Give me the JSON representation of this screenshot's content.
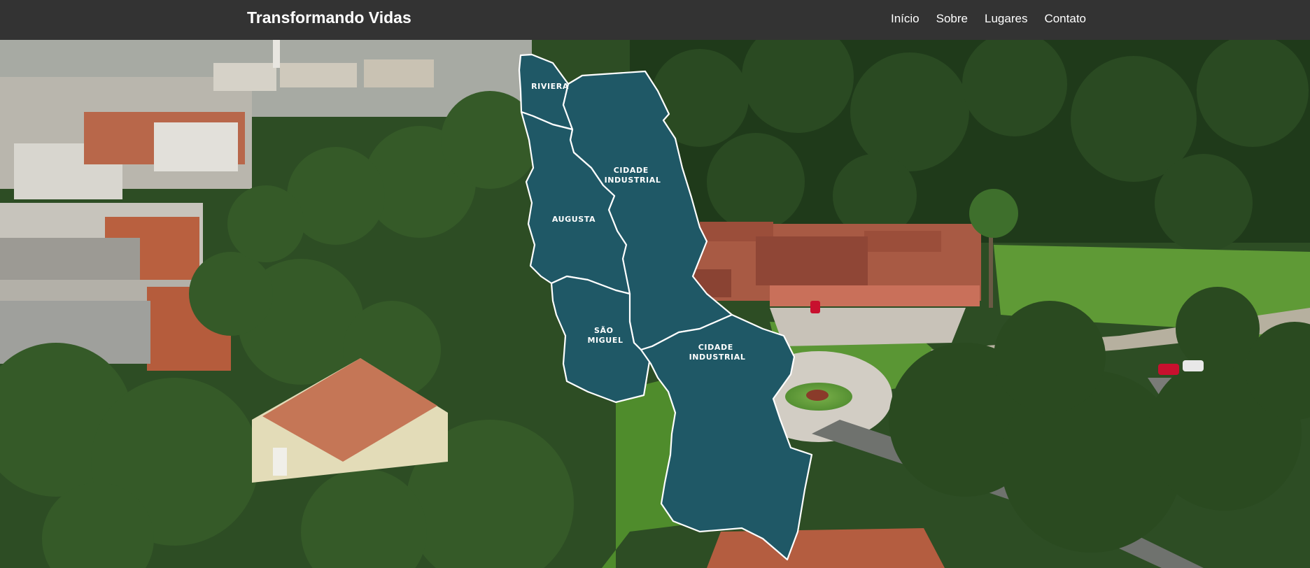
{
  "navbar": {
    "brand": "Transformando Vidas",
    "links": [
      {
        "label": "Início"
      },
      {
        "label": "Sobre"
      },
      {
        "label": "Lugares"
      },
      {
        "label": "Contato"
      }
    ]
  },
  "map": {
    "fill_color": "#1f5866",
    "border_color": "#ffffff",
    "regions": [
      {
        "name": "riviera",
        "lines": [
          "RIVIERA"
        ]
      },
      {
        "name": "cidade-industrial-north",
        "lines": [
          "CIDADE",
          "INDUSTRIAL"
        ]
      },
      {
        "name": "augusta",
        "lines": [
          "AUGUSTA"
        ]
      },
      {
        "name": "sao-miguel",
        "lines": [
          "SÃO",
          "MIGUEL"
        ]
      },
      {
        "name": "cidade-industrial-south",
        "lines": [
          "CIDADE",
          "INDUSTRIAL"
        ]
      }
    ]
  }
}
